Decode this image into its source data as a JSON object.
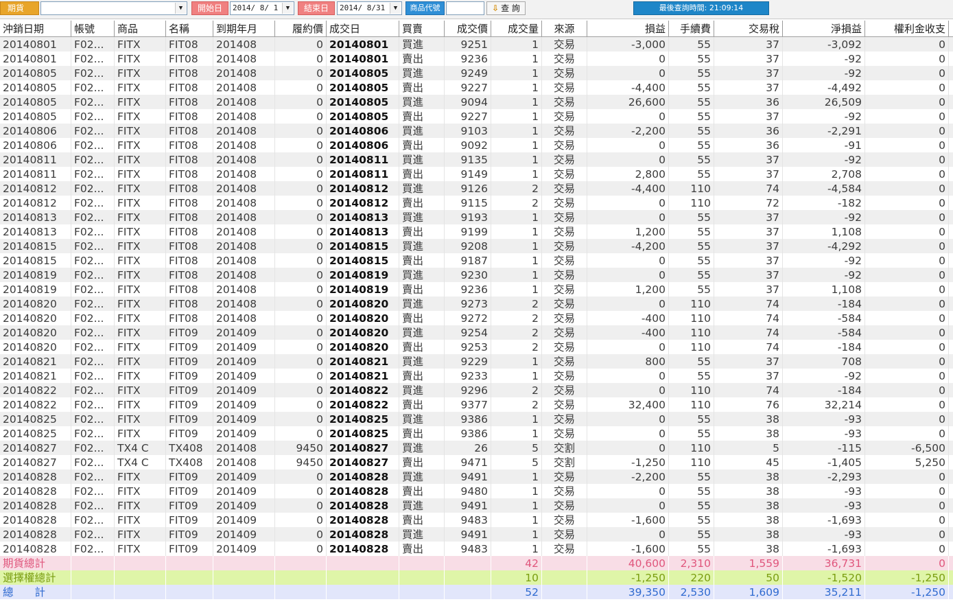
{
  "toolbar": {
    "category_label": "期貨",
    "category_value": "",
    "start_label": "開始日",
    "start_value": "2014/ 8/ 1",
    "end_label": "結束日",
    "end_value": "2014/ 8/31",
    "product_code_label": "商品代號",
    "product_code_value": "",
    "query_label": "查 詢",
    "last_query_time": "最後查詢時間: 21:09:14"
  },
  "columns": [
    "沖銷日期",
    "帳號",
    "商品",
    "名稱",
    "到期年月",
    "履約價",
    "成交日",
    "買賣",
    "成交價",
    "成交量",
    "來源",
    "損益",
    "手續費",
    "交易稅",
    "淨損益",
    "權利金收支"
  ],
  "rows": [
    [
      "20140801",
      "F02...",
      "FITX",
      "FIT08",
      "201408",
      "0",
      "20140801",
      "買進",
      "9251",
      "1",
      "交易",
      "-3,000",
      "55",
      "37",
      "-3,092",
      "0"
    ],
    [
      "20140801",
      "F02...",
      "FITX",
      "FIT08",
      "201408",
      "0",
      "20140801",
      "賣出",
      "9236",
      "1",
      "交易",
      "0",
      "55",
      "37",
      "-92",
      "0"
    ],
    [
      "20140805",
      "F02...",
      "FITX",
      "FIT08",
      "201408",
      "0",
      "20140805",
      "買進",
      "9249",
      "1",
      "交易",
      "0",
      "55",
      "37",
      "-92",
      "0"
    ],
    [
      "20140805",
      "F02...",
      "FITX",
      "FIT08",
      "201408",
      "0",
      "20140805",
      "賣出",
      "9227",
      "1",
      "交易",
      "-4,400",
      "55",
      "37",
      "-4,492",
      "0"
    ],
    [
      "20140805",
      "F02...",
      "FITX",
      "FIT08",
      "201408",
      "0",
      "20140805",
      "買進",
      "9094",
      "1",
      "交易",
      "26,600",
      "55",
      "36",
      "26,509",
      "0"
    ],
    [
      "20140805",
      "F02...",
      "FITX",
      "FIT08",
      "201408",
      "0",
      "20140805",
      "賣出",
      "9227",
      "1",
      "交易",
      "0",
      "55",
      "37",
      "-92",
      "0"
    ],
    [
      "20140806",
      "F02...",
      "FITX",
      "FIT08",
      "201408",
      "0",
      "20140806",
      "買進",
      "9103",
      "1",
      "交易",
      "-2,200",
      "55",
      "36",
      "-2,291",
      "0"
    ],
    [
      "20140806",
      "F02...",
      "FITX",
      "FIT08",
      "201408",
      "0",
      "20140806",
      "賣出",
      "9092",
      "1",
      "交易",
      "0",
      "55",
      "36",
      "-91",
      "0"
    ],
    [
      "20140811",
      "F02...",
      "FITX",
      "FIT08",
      "201408",
      "0",
      "20140811",
      "買進",
      "9135",
      "1",
      "交易",
      "0",
      "55",
      "37",
      "-92",
      "0"
    ],
    [
      "20140811",
      "F02...",
      "FITX",
      "FIT08",
      "201408",
      "0",
      "20140811",
      "賣出",
      "9149",
      "1",
      "交易",
      "2,800",
      "55",
      "37",
      "2,708",
      "0"
    ],
    [
      "20140812",
      "F02...",
      "FITX",
      "FIT08",
      "201408",
      "0",
      "20140812",
      "買進",
      "9126",
      "2",
      "交易",
      "-4,400",
      "110",
      "74",
      "-4,584",
      "0"
    ],
    [
      "20140812",
      "F02...",
      "FITX",
      "FIT08",
      "201408",
      "0",
      "20140812",
      "賣出",
      "9115",
      "2",
      "交易",
      "0",
      "110",
      "72",
      "-182",
      "0"
    ],
    [
      "20140813",
      "F02...",
      "FITX",
      "FIT08",
      "201408",
      "0",
      "20140813",
      "買進",
      "9193",
      "1",
      "交易",
      "0",
      "55",
      "37",
      "-92",
      "0"
    ],
    [
      "20140813",
      "F02...",
      "FITX",
      "FIT08",
      "201408",
      "0",
      "20140813",
      "賣出",
      "9199",
      "1",
      "交易",
      "1,200",
      "55",
      "37",
      "1,108",
      "0"
    ],
    [
      "20140815",
      "F02...",
      "FITX",
      "FIT08",
      "201408",
      "0",
      "20140815",
      "買進",
      "9208",
      "1",
      "交易",
      "-4,200",
      "55",
      "37",
      "-4,292",
      "0"
    ],
    [
      "20140815",
      "F02...",
      "FITX",
      "FIT08",
      "201408",
      "0",
      "20140815",
      "賣出",
      "9187",
      "1",
      "交易",
      "0",
      "55",
      "37",
      "-92",
      "0"
    ],
    [
      "20140819",
      "F02...",
      "FITX",
      "FIT08",
      "201408",
      "0",
      "20140819",
      "買進",
      "9230",
      "1",
      "交易",
      "0",
      "55",
      "37",
      "-92",
      "0"
    ],
    [
      "20140819",
      "F02...",
      "FITX",
      "FIT08",
      "201408",
      "0",
      "20140819",
      "賣出",
      "9236",
      "1",
      "交易",
      "1,200",
      "55",
      "37",
      "1,108",
      "0"
    ],
    [
      "20140820",
      "F02...",
      "FITX",
      "FIT08",
      "201408",
      "0",
      "20140820",
      "買進",
      "9273",
      "2",
      "交易",
      "0",
      "110",
      "74",
      "-184",
      "0"
    ],
    [
      "20140820",
      "F02...",
      "FITX",
      "FIT08",
      "201408",
      "0",
      "20140820",
      "賣出",
      "9272",
      "2",
      "交易",
      "-400",
      "110",
      "74",
      "-584",
      "0"
    ],
    [
      "20140820",
      "F02...",
      "FITX",
      "FIT09",
      "201409",
      "0",
      "20140820",
      "買進",
      "9254",
      "2",
      "交易",
      "-400",
      "110",
      "74",
      "-584",
      "0"
    ],
    [
      "20140820",
      "F02...",
      "FITX",
      "FIT09",
      "201409",
      "0",
      "20140820",
      "賣出",
      "9253",
      "2",
      "交易",
      "0",
      "110",
      "74",
      "-184",
      "0"
    ],
    [
      "20140821",
      "F02...",
      "FITX",
      "FIT09",
      "201409",
      "0",
      "20140821",
      "買進",
      "9229",
      "1",
      "交易",
      "800",
      "55",
      "37",
      "708",
      "0"
    ],
    [
      "20140821",
      "F02...",
      "FITX",
      "FIT09",
      "201409",
      "0",
      "20140821",
      "賣出",
      "9233",
      "1",
      "交易",
      "0",
      "55",
      "37",
      "-92",
      "0"
    ],
    [
      "20140822",
      "F02...",
      "FITX",
      "FIT09",
      "201409",
      "0",
      "20140822",
      "買進",
      "9296",
      "2",
      "交易",
      "0",
      "110",
      "74",
      "-184",
      "0"
    ],
    [
      "20140822",
      "F02...",
      "FITX",
      "FIT09",
      "201409",
      "0",
      "20140822",
      "賣出",
      "9377",
      "2",
      "交易",
      "32,400",
      "110",
      "76",
      "32,214",
      "0"
    ],
    [
      "20140825",
      "F02...",
      "FITX",
      "FIT09",
      "201409",
      "0",
      "20140825",
      "買進",
      "9386",
      "1",
      "交易",
      "0",
      "55",
      "38",
      "-93",
      "0"
    ],
    [
      "20140825",
      "F02...",
      "FITX",
      "FIT09",
      "201409",
      "0",
      "20140825",
      "賣出",
      "9386",
      "1",
      "交易",
      "0",
      "55",
      "38",
      "-93",
      "0"
    ],
    [
      "20140827",
      "F02...",
      "TX4   C",
      "TX408",
      "201408",
      "9450",
      "20140827",
      "買進",
      "26",
      "5",
      "交割",
      "0",
      "110",
      "5",
      "-115",
      "-6,500"
    ],
    [
      "20140827",
      "F02...",
      "TX4   C",
      "TX408",
      "201408",
      "9450",
      "20140827",
      "賣出",
      "9471",
      "5",
      "交割",
      "-1,250",
      "110",
      "45",
      "-1,405",
      "5,250"
    ],
    [
      "20140828",
      "F02...",
      "FITX",
      "FIT09",
      "201409",
      "0",
      "20140828",
      "買進",
      "9491",
      "1",
      "交易",
      "-2,200",
      "55",
      "38",
      "-2,293",
      "0"
    ],
    [
      "20140828",
      "F02...",
      "FITX",
      "FIT09",
      "201409",
      "0",
      "20140828",
      "賣出",
      "9480",
      "1",
      "交易",
      "0",
      "55",
      "38",
      "-93",
      "0"
    ],
    [
      "20140828",
      "F02...",
      "FITX",
      "FIT09",
      "201409",
      "0",
      "20140828",
      "買進",
      "9491",
      "1",
      "交易",
      "0",
      "55",
      "38",
      "-93",
      "0"
    ],
    [
      "20140828",
      "F02...",
      "FITX",
      "FIT09",
      "201409",
      "0",
      "20140828",
      "賣出",
      "9483",
      "1",
      "交易",
      "-1,600",
      "55",
      "38",
      "-1,693",
      "0"
    ],
    [
      "20140828",
      "F02...",
      "FITX",
      "FIT09",
      "201409",
      "0",
      "20140828",
      "買進",
      "9491",
      "1",
      "交易",
      "0",
      "55",
      "38",
      "-93",
      "0"
    ],
    [
      "20140828",
      "F02...",
      "FITX",
      "FIT09",
      "201409",
      "0",
      "20140828",
      "賣出",
      "9483",
      "1",
      "交易",
      "-1,600",
      "55",
      "38",
      "-1,693",
      "0"
    ]
  ],
  "summaries": {
    "futures": {
      "label": "期貨總計",
      "qty": "42",
      "pnl": "40,600",
      "fee": "2,310",
      "tax": "1,559",
      "net": "36,731",
      "premium": "0"
    },
    "options": {
      "label": "選擇權總計",
      "qty": "10",
      "pnl": "-1,250",
      "fee": "220",
      "tax": "50",
      "net": "-1,520",
      "premium": "-1,250"
    },
    "total": {
      "label": "總　　計",
      "qty": "52",
      "pnl": "39,350",
      "fee": "2,530",
      "tax": "1,609",
      "net": "35,211",
      "premium": "-1,250"
    }
  },
  "colors": {
    "category_tag": "#e8a52a",
    "date_tag": "#f08080",
    "code_tag": "#2f8fd6",
    "futures_total": "#e0567d",
    "options_total": "#7a9d10",
    "grand_total": "#2f6ad0"
  }
}
